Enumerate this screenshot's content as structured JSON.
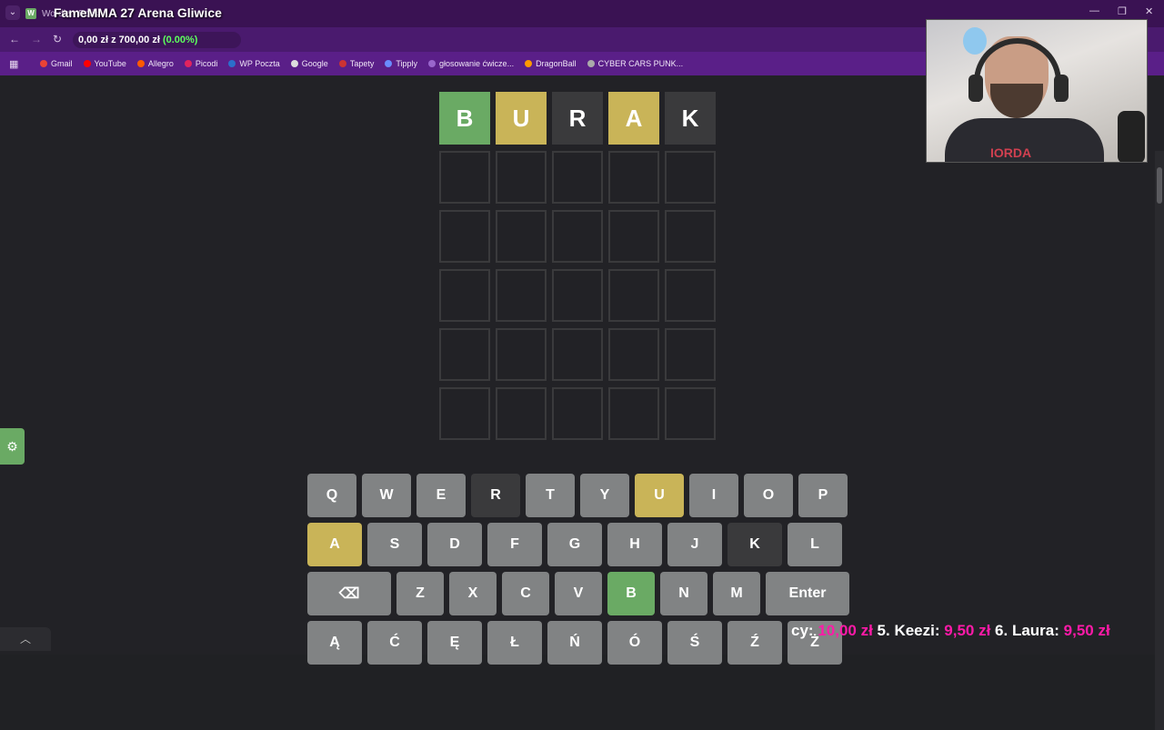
{
  "browser": {
    "tab_title": "Wordle - Polish",
    "overlay_title": "FameMMA 27 Arena Gliwice",
    "donation_text": "0,00 zł z 700,00 zł",
    "donation_pct": "(0.00%)",
    "bookmarks": [
      {
        "label": "Gmail",
        "color": "#ea4335"
      },
      {
        "label": "YouTube",
        "color": "#ff0000"
      },
      {
        "label": "Allegro",
        "color": "#ff5a00"
      },
      {
        "label": "Picodi",
        "color": "#e0245e"
      },
      {
        "label": "WP Poczta",
        "color": "#2c6ecb"
      },
      {
        "label": "Google",
        "color": "#dddddd"
      },
      {
        "label": "Tapety",
        "color": "#cc3333"
      },
      {
        "label": "Tipply",
        "color": "#6a8cff"
      },
      {
        "label": "głosowanie ćwicze...",
        "color": "#9966cc"
      },
      {
        "label": "DragonBall",
        "color": "#ff9900"
      },
      {
        "label": "CYBER CARS PUNK...",
        "color": "#aaaaaa"
      }
    ]
  },
  "board": {
    "rows": [
      [
        {
          "letter": "B",
          "state": "green"
        },
        {
          "letter": "U",
          "state": "yellow"
        },
        {
          "letter": "R",
          "state": "gray"
        },
        {
          "letter": "A",
          "state": "yellow"
        },
        {
          "letter": "K",
          "state": "gray"
        }
      ],
      [
        {
          "letter": "",
          "state": "empty"
        },
        {
          "letter": "",
          "state": "empty"
        },
        {
          "letter": "",
          "state": "empty"
        },
        {
          "letter": "",
          "state": "empty"
        },
        {
          "letter": "",
          "state": "empty"
        }
      ],
      [
        {
          "letter": "",
          "state": "empty"
        },
        {
          "letter": "",
          "state": "empty"
        },
        {
          "letter": "",
          "state": "empty"
        },
        {
          "letter": "",
          "state": "empty"
        },
        {
          "letter": "",
          "state": "empty"
        }
      ],
      [
        {
          "letter": "",
          "state": "empty"
        },
        {
          "letter": "",
          "state": "empty"
        },
        {
          "letter": "",
          "state": "empty"
        },
        {
          "letter": "",
          "state": "empty"
        },
        {
          "letter": "",
          "state": "empty"
        }
      ],
      [
        {
          "letter": "",
          "state": "empty"
        },
        {
          "letter": "",
          "state": "empty"
        },
        {
          "letter": "",
          "state": "empty"
        },
        {
          "letter": "",
          "state": "empty"
        },
        {
          "letter": "",
          "state": "empty"
        }
      ],
      [
        {
          "letter": "",
          "state": "empty"
        },
        {
          "letter": "",
          "state": "empty"
        },
        {
          "letter": "",
          "state": "empty"
        },
        {
          "letter": "",
          "state": "empty"
        },
        {
          "letter": "",
          "state": "empty"
        }
      ]
    ]
  },
  "keyboard": {
    "row1": [
      {
        "k": "Q",
        "s": ""
      },
      {
        "k": "W",
        "s": ""
      },
      {
        "k": "E",
        "s": ""
      },
      {
        "k": "R",
        "s": "absent"
      },
      {
        "k": "T",
        "s": ""
      },
      {
        "k": "Y",
        "s": ""
      },
      {
        "k": "U",
        "s": "yellow"
      },
      {
        "k": "I",
        "s": ""
      },
      {
        "k": "O",
        "s": ""
      },
      {
        "k": "P",
        "s": ""
      }
    ],
    "row2": [
      {
        "k": "A",
        "s": "yellow"
      },
      {
        "k": "S",
        "s": ""
      },
      {
        "k": "D",
        "s": ""
      },
      {
        "k": "F",
        "s": ""
      },
      {
        "k": "G",
        "s": ""
      },
      {
        "k": "H",
        "s": ""
      },
      {
        "k": "J",
        "s": ""
      },
      {
        "k": "K",
        "s": "absent"
      },
      {
        "k": "L",
        "s": ""
      }
    ],
    "row3": [
      {
        "k": "⌫",
        "s": ""
      },
      {
        "k": "Z",
        "s": ""
      },
      {
        "k": "X",
        "s": ""
      },
      {
        "k": "C",
        "s": ""
      },
      {
        "k": "V",
        "s": ""
      },
      {
        "k": "B",
        "s": "green"
      },
      {
        "k": "N",
        "s": ""
      },
      {
        "k": "M",
        "s": ""
      },
      {
        "k": "Enter",
        "s": ""
      }
    ],
    "row4": [
      {
        "k": "Ą",
        "s": ""
      },
      {
        "k": "Ć",
        "s": ""
      },
      {
        "k": "Ę",
        "s": ""
      },
      {
        "k": "Ł",
        "s": ""
      },
      {
        "k": "Ń",
        "s": ""
      },
      {
        "k": "Ó",
        "s": ""
      },
      {
        "k": "Ś",
        "s": ""
      },
      {
        "k": "Ź",
        "s": ""
      },
      {
        "k": "Ż",
        "s": ""
      }
    ]
  },
  "webcam": {
    "shirt_text": "IORDA"
  },
  "ticker": {
    "prefix": "cy:",
    "amt1": "10,00 zł",
    "name2": "5. Keezi:",
    "amt2": "9,50 zł",
    "name3": "6. Laura:",
    "amt3": "9,50 zł"
  },
  "colors": {
    "green": "#6aaa64",
    "yellow": "#c9b458",
    "absent": "#3a3a3c",
    "key": "#818384"
  }
}
